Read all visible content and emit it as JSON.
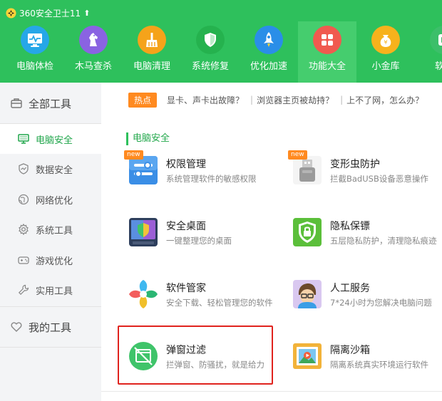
{
  "app": {
    "title": "360安全卫士11",
    "update_icon": "up-arrow-icon"
  },
  "nav": [
    {
      "label": "电脑体检",
      "icon": "monitor-pulse-icon",
      "color": "#26a7e8"
    },
    {
      "label": "木马查杀",
      "icon": "horse-icon",
      "color": "#8a63e2"
    },
    {
      "label": "电脑清理",
      "icon": "broom-icon",
      "color": "#f5a31a"
    },
    {
      "label": "系统修复",
      "icon": "shield-icon",
      "color": "#25b24e"
    },
    {
      "label": "优化加速",
      "icon": "rocket-icon",
      "color": "#2a8ee8"
    },
    {
      "label": "功能大全",
      "icon": "grid-icon",
      "color": "#f05a4f",
      "active": true
    },
    {
      "label": "小金库",
      "icon": "coin-bag-icon",
      "color": "#f7b21c"
    },
    {
      "label": "软件",
      "icon": "software-icon",
      "color": "#3cbf6a"
    }
  ],
  "sidebar": {
    "all_tools": "全部工具",
    "items": [
      {
        "label": "电脑安全",
        "icon": "monitor-icon",
        "active": true
      },
      {
        "label": "数据安全",
        "icon": "shield-data-icon"
      },
      {
        "label": "网络优化",
        "icon": "globe-icon"
      },
      {
        "label": "系统工具",
        "icon": "gear-icon"
      },
      {
        "label": "游戏优化",
        "icon": "gamepad-icon"
      },
      {
        "label": "实用工具",
        "icon": "wrench-icon"
      }
    ],
    "my_tools": "我的工具"
  },
  "hot": {
    "badge": "热点",
    "links": [
      "显卡、声卡出故障？",
      "浏览器主页被劫持？",
      "上不了网，怎么办？"
    ]
  },
  "section_title": "电脑安全",
  "tools": [
    {
      "name": "权限管理",
      "desc": "系统管理软件的敏感权限",
      "icon": "permission-icon",
      "badge": "new"
    },
    {
      "name": "变形虫防护",
      "desc": "拦截BadUSB设备恶意操作",
      "icon": "usb-guard-icon",
      "badge": "new"
    },
    {
      "name": "安全桌面",
      "desc": "一键整理您的桌面",
      "icon": "secure-desktop-icon"
    },
    {
      "name": "隐私保镖",
      "desc": "五层隐私防护，清理隐私痕迹",
      "icon": "privacy-lock-icon"
    },
    {
      "name": "软件管家",
      "desc": "安全下载、轻松管理您的软件",
      "icon": "software-manager-icon"
    },
    {
      "name": "人工服务",
      "desc": "7*24小时为您解决电脑问题",
      "icon": "human-service-icon"
    },
    {
      "name": "弹窗过滤",
      "desc": "拦弹窗、防骚扰，就是给力",
      "icon": "popup-filter-icon",
      "highlighted": true
    },
    {
      "name": "隔离沙箱",
      "desc": "隔离系统真实环境运行软件",
      "icon": "sandbox-icon"
    }
  ]
}
